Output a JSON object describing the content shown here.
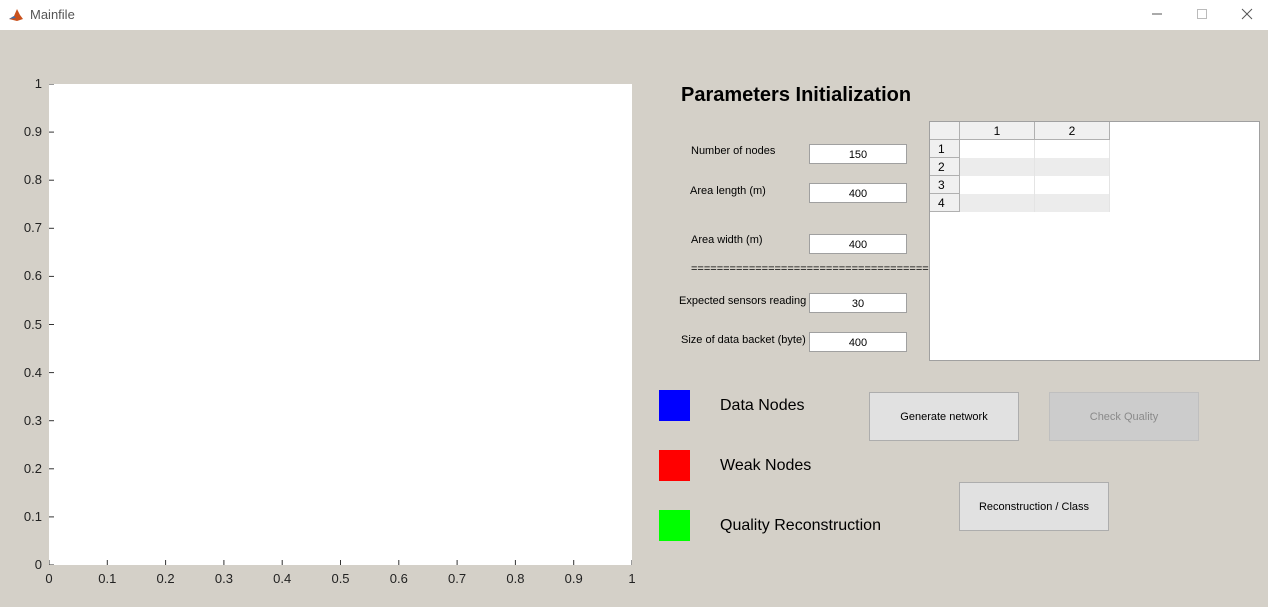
{
  "window": {
    "title": "Mainfile",
    "minimize_icon": "minimize-icon",
    "maximize_icon": "maximize-icon",
    "close_icon": "close-icon"
  },
  "axes": {
    "y_ticks": [
      "1",
      "0.9",
      "0.8",
      "0.7",
      "0.6",
      "0.5",
      "0.4",
      "0.3",
      "0.2",
      "0.1",
      "0"
    ],
    "x_ticks": [
      "0",
      "0.1",
      "0.2",
      "0.3",
      "0.4",
      "0.5",
      "0.6",
      "0.7",
      "0.8",
      "0.9",
      "1"
    ]
  },
  "params": {
    "title": "Parameters Initialization",
    "num_nodes_label": "Number of nodes",
    "num_nodes_value": "150",
    "area_length_label": "Area length (m)",
    "area_length_value": "400",
    "area_width_label": "Area width (m)",
    "area_width_value": "400",
    "separator": "=====================================",
    "expected_label": "Expected sensors reading",
    "expected_value": "30",
    "packet_label": "Size of data backet (byte)",
    "packet_value": "400"
  },
  "table": {
    "columns": [
      "1",
      "2"
    ],
    "rows": [
      "1",
      "2",
      "3",
      "4"
    ]
  },
  "legend": {
    "data_nodes": "Data Nodes",
    "data_nodes_color": "#0000ff",
    "weak_nodes": "Weak Nodes",
    "weak_nodes_color": "#ff0000",
    "quality": "Quality Reconstruction",
    "quality_color": "#00ff00"
  },
  "buttons": {
    "generate": "Generate network",
    "check": "Check Quality",
    "reconstruction": "Reconstruction / Class"
  }
}
